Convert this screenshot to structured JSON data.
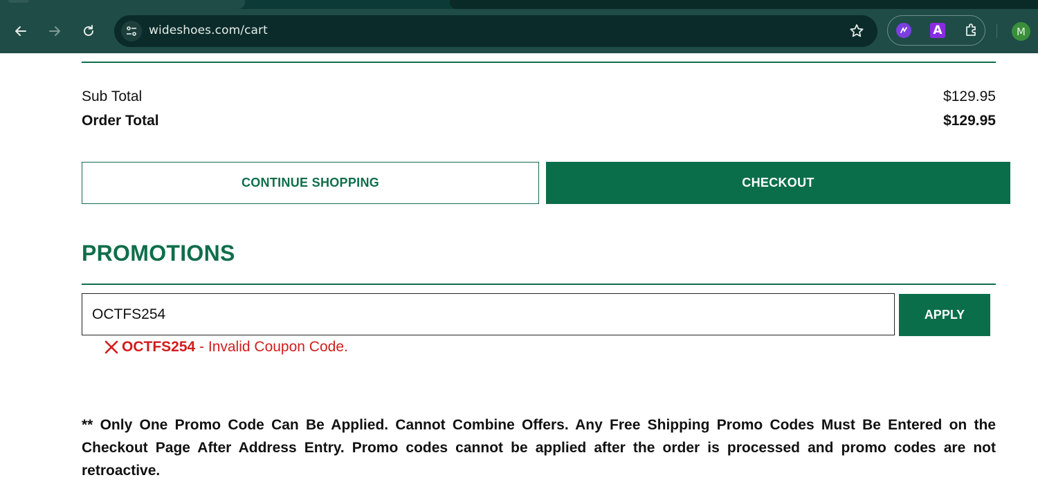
{
  "browser": {
    "url": "wideshoes.com/cart",
    "profile_initial": "M",
    "extension_letter": "A"
  },
  "summary": {
    "subtotal_label": "Sub Total",
    "subtotal_value": "$129.95",
    "order_total_label": "Order Total",
    "order_total_value": "$129.95"
  },
  "actions": {
    "continue_label": "CONTINUE SHOPPING",
    "checkout_label": "CHECKOUT"
  },
  "promotions": {
    "title": "PROMOTIONS",
    "input_value": "OCTFS254",
    "apply_label": "APPLY",
    "error_code": "OCTFS254",
    "error_message": " - Invalid Coupon Code."
  },
  "disclaimer": "** Only One Promo Code Can Be Applied. Cannot Combine Offers. Any Free Shipping Promo Codes Must Be Entered on the Checkout Page After Address Entry. Promo codes cannot be applied after the order is processed and promo codes are not retroactive.",
  "colors": {
    "brand_green": "#0a6e4a",
    "error_red": "#d21c1c",
    "chrome_bg": "#1f4c47"
  }
}
